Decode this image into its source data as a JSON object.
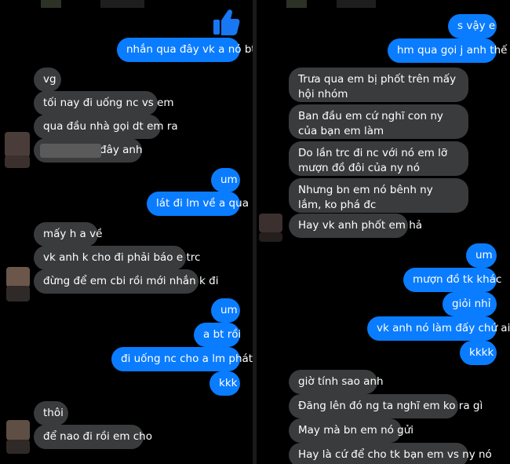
{
  "colors": {
    "background": "#000000",
    "incoming_bubble": "#3a3b3c",
    "outgoing_bubble": "#0a7cff",
    "text": "#ffffff"
  },
  "left": {
    "like_icon": "thumbs-up-icon",
    "messages": [
      {
        "id": "l1",
        "dir": "out",
        "text": "nhắn qua đây vk a nó bt"
      },
      {
        "id": "l2",
        "dir": "in",
        "text": "vg"
      },
      {
        "id": "l3",
        "dir": "in",
        "text": "tối nay đi uống nc vs em"
      },
      {
        "id": "l4",
        "dir": "in",
        "text": "qua đầu nhà gọi dt em ra"
      },
      {
        "id": "l5",
        "dir": "in",
        "text": "đây anh"
      },
      {
        "id": "l6",
        "dir": "out",
        "text": "um"
      },
      {
        "id": "l7",
        "dir": "out",
        "text": "lát đi lm về a qua"
      },
      {
        "id": "l8",
        "dir": "in",
        "text": "mấy h a về"
      },
      {
        "id": "l9",
        "dir": "in",
        "text": "vk anh k cho đi phải báo e trc"
      },
      {
        "id": "l10",
        "dir": "in",
        "text": "đừng để em cbi rồi mới nhắn k đi"
      },
      {
        "id": "l11",
        "dir": "out",
        "text": "um"
      },
      {
        "id": "l12",
        "dir": "out",
        "text": "a bt rồi"
      },
      {
        "id": "l13",
        "dir": "out",
        "text": "đi uống nc cho a lm phát"
      },
      {
        "id": "l14",
        "dir": "out",
        "text": "kkk"
      },
      {
        "id": "l15",
        "dir": "in",
        "text": "thôi"
      },
      {
        "id": "l16",
        "dir": "in",
        "text": "để nao đi rồi em cho"
      }
    ]
  },
  "right": {
    "messages": [
      {
        "id": "r1",
        "dir": "out",
        "text": "s vậy e"
      },
      {
        "id": "r2",
        "dir": "out",
        "text": "hm qua gọi j anh thế"
      },
      {
        "id": "r3",
        "dir": "in",
        "text": "Trưa qua em bị phốt trên mấy hội nhóm"
      },
      {
        "id": "r4",
        "dir": "in",
        "text": "Ban đầu em cứ nghĩ con ny của bạn em làm"
      },
      {
        "id": "r5",
        "dir": "in",
        "text": "Do lần trc đi nc với nó em lỡ mượn đồ đôi của ny nó"
      },
      {
        "id": "r6",
        "dir": "in",
        "text": "Nhưng bn em nó bênh ny lắm, ko phá đc"
      },
      {
        "id": "r7",
        "dir": "in",
        "text": "Hay vk anh phốt em hả"
      },
      {
        "id": "r8",
        "dir": "out",
        "text": "um"
      },
      {
        "id": "r9",
        "dir": "out",
        "text": "mượn đồ tk khác"
      },
      {
        "id": "r10",
        "dir": "out",
        "text": "giỏi nhỉ"
      },
      {
        "id": "r11",
        "dir": "out",
        "text": "vk anh nó làm đấy chứ ai"
      },
      {
        "id": "r12",
        "dir": "out",
        "text": "kkkk"
      },
      {
        "id": "r13",
        "dir": "in",
        "text": "giờ tính sao anh"
      },
      {
        "id": "r14",
        "dir": "in",
        "text": "Đăng lên đó ng ta nghĩ em ko ra gì"
      },
      {
        "id": "r15",
        "dir": "in",
        "text": "May mà bn em nó gửi"
      },
      {
        "id": "r16",
        "dir": "in",
        "text": "Hay là cứ để cho tk bạn em vs ny nó"
      }
    ]
  }
}
